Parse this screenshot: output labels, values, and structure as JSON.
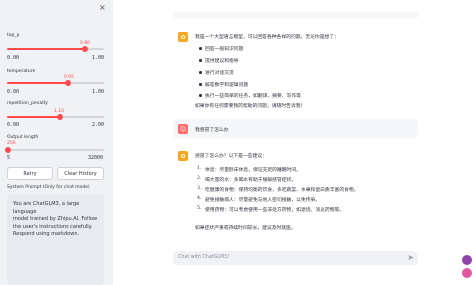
{
  "sidebar": {
    "close_icon": "×",
    "sliders": [
      {
        "label": "top_p",
        "value": "0.80",
        "fraction": 0.8,
        "min": "0.00",
        "max": "1.00"
      },
      {
        "label": "temperature",
        "value": "0.95",
        "fraction": 0.95,
        "min": "0.00",
        "max": "1.00"
      },
      {
        "label": "repetition_penalty",
        "value": "1.10",
        "fraction": 0.55,
        "min": "0.00",
        "max": "2.00"
      },
      {
        "label": "Output length",
        "value": "256",
        "fraction": 0.0,
        "min": "5",
        "max": "32000"
      }
    ],
    "retry_label": "Retry",
    "clear_label": "Clear History",
    "system_prompt_label": "System Prompt (Only for chat mode)",
    "system_prompt_lines": [
      "You are ChatGLM3, a large language",
      "model trained by Zhipu.AI. Follow",
      "the user's instructions carefully.",
      "Respond using markdown."
    ]
  },
  "chat": {
    "bot_icon": "bot-icon",
    "user_icon": "user-icon",
    "message1": {
      "intro": "我是一个大型语言模型，可以回答各种各样的问题。无论你是想了：",
      "bullets": [
        "回答一般知识问题",
        "提供建议和指导",
        "进行对话交流",
        "解答数学和逻辑问题",
        "执行一些简单的任务，如翻译、摘要、写作等"
      ],
      "outro": "如果你有任何需要我的帮助的问题，请随时告诉我！"
    },
    "message2": {
      "text": "我感冒了怎么办"
    },
    "message3": {
      "intro": "感冒了怎么办？以下是一些建议：",
      "items": [
        {
          "n": "1.",
          "text": "休息：尽量卧床休息，保证充足的睡眠时间。"
        },
        {
          "n": "2.",
          "text": "喝大量的水：多喝水有助于缓解感冒症状。"
        },
        {
          "n": "3.",
          "text": "吃健康的食物：保持均衡的饮食，多吃蔬菜、水果和蛋白质丰富的食物。"
        },
        {
          "n": "4.",
          "text": "避免接触病人：尽量避免与他人密切接触，以免传染。"
        },
        {
          "n": "5.",
          "text": "使用药物：可以考虑使用一些非处方药物，如退烧、消炎药物等。"
        }
      ],
      "outro": "如果症状严重或持续时间较长，建议及时就医。"
    },
    "input_placeholder": "Chat with ChatGLM3!",
    "send_icon": "send-icon"
  }
}
